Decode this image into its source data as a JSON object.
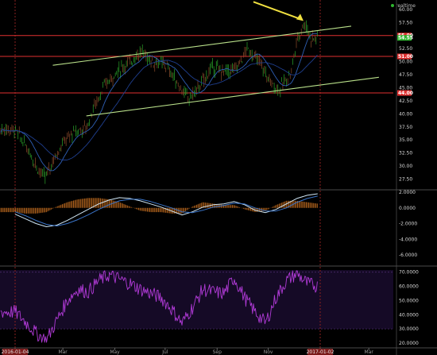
{
  "chart_data": [
    {
      "type": "candlestick",
      "panel": "price",
      "brand": "realtime",
      "y_ticks": [
        "60.00",
        "57.50",
        "55.00",
        "54.55",
        "52.50",
        "51.00",
        "50.00",
        "47.50",
        "45.00",
        "44.00",
        "42.50",
        "40.00",
        "37.50",
        "35.00",
        "32.50",
        "30.00",
        "27.50"
      ],
      "ylim": [
        25.6,
        61.5
      ],
      "x_ticks": [
        "2016-01-04",
        "Mar",
        "May",
        "Jul",
        "Sep",
        "Nov",
        "2017-01-02",
        "Mar"
      ],
      "horizontal_levels": [
        {
          "value": 55.0,
          "label": "55.00",
          "color": "#e03030"
        },
        {
          "value": 54.55,
          "label": "54.55",
          "color": "#2fb52f"
        },
        {
          "value": 51.0,
          "label": "51.00",
          "color": "#e03030"
        },
        {
          "value": 44.0,
          "label": "44.00",
          "color": "#e03030"
        }
      ],
      "price_series": [
        {
          "date": "2016-01-04",
          "close": 37.0
        },
        {
          "date": "2016-01-20",
          "close": 33.0
        },
        {
          "date": "2016-02-02",
          "close": 29.0
        },
        {
          "date": "2016-02-09",
          "close": 27.8
        },
        {
          "date": "2016-02-18",
          "close": 31.0
        },
        {
          "date": "2016-03-01",
          "close": 34.5
        },
        {
          "date": "2016-03-15",
          "close": 36.5
        },
        {
          "date": "2016-03-29",
          "close": 37.3
        },
        {
          "date": "2016-04-06",
          "close": 41.0
        },
        {
          "date": "2016-04-20",
          "close": 45.5
        },
        {
          "date": "2016-05-04",
          "close": 48.0
        },
        {
          "date": "2016-05-20",
          "close": 50.0
        },
        {
          "date": "2016-06-03",
          "close": 52.0
        },
        {
          "date": "2016-06-15",
          "close": 50.0
        },
        {
          "date": "2016-07-01",
          "close": 49.5
        },
        {
          "date": "2016-07-15",
          "close": 46.0
        },
        {
          "date": "2016-07-29",
          "close": 42.8
        },
        {
          "date": "2016-08-12",
          "close": 45.5
        },
        {
          "date": "2016-08-26",
          "close": 49.0
        },
        {
          "date": "2016-09-09",
          "close": 48.0
        },
        {
          "date": "2016-09-23",
          "close": 48.5
        },
        {
          "date": "2016-10-07",
          "close": 52.5
        },
        {
          "date": "2016-10-21",
          "close": 50.0
        },
        {
          "date": "2016-11-04",
          "close": 46.0
        },
        {
          "date": "2016-11-14",
          "close": 44.5
        },
        {
          "date": "2016-11-28",
          "close": 48.0
        },
        {
          "date": "2016-12-05",
          "close": 54.0
        },
        {
          "date": "2016-12-14",
          "close": 57.5
        },
        {
          "date": "2016-12-22",
          "close": 54.5
        },
        {
          "date": "2016-12-30",
          "close": 54.55
        }
      ],
      "trendlines": [
        {
          "from": {
            "date": "2016-02-18",
            "value": 49.3
          },
          "to": {
            "date": "2017-02-08",
            "value": 56.8
          }
        },
        {
          "from": {
            "date": "2016-03-29",
            "value": 39.6
          },
          "to": {
            "date": "2017-03-13",
            "value": 47.0
          }
        }
      ],
      "annotation": {
        "type": "arrow",
        "color": "#f0e040",
        "points_to": {
          "date": "2016-12-14",
          "value": 57.8
        }
      }
    },
    {
      "type": "line",
      "panel": "macd",
      "y_ticks": [
        "2.0000",
        "0.0000",
        "-2.0000",
        "-4.0000",
        "-6.0000"
      ],
      "ylim": [
        -6.6,
        2.2
      ],
      "series": [
        {
          "color": "#cfe6f5",
          "values": [
            -0.8,
            -1.4,
            -2.0,
            -2.4,
            -2.2,
            -1.6,
            -0.9,
            -0.2,
            0.5,
            1.0,
            1.3,
            1.2,
            0.9,
            0.5,
            0.1,
            -0.4,
            -0.9,
            -0.5,
            0.1,
            0.4,
            0.5,
            0.8,
            0.4,
            -0.3,
            -0.6,
            -0.2,
            0.5,
            1.2,
            1.6,
            1.8
          ]
        },
        {
          "color": "#3a74c8",
          "values": [
            -0.5,
            -1.0,
            -1.6,
            -2.1,
            -2.3,
            -2.0,
            -1.5,
            -0.9,
            -0.2,
            0.4,
            0.9,
            1.1,
            1.1,
            0.8,
            0.4,
            0.0,
            -0.5,
            -0.6,
            -0.3,
            0.1,
            0.3,
            0.6,
            0.5,
            0.0,
            -0.4,
            -0.4,
            0.0,
            0.7,
            1.2,
            1.5
          ]
        }
      ]
    },
    {
      "type": "line",
      "panel": "rsi",
      "y_ticks": [
        "70.0000",
        "60.0000",
        "50.0000",
        "40.0000",
        "30.0000",
        "20.0000"
      ],
      "ylim": [
        20.0,
        71.5
      ],
      "band": [
        30,
        70
      ],
      "series": [
        {
          "color": "#b03ad6",
          "values": [
            42,
            35,
            27,
            22,
            36,
            50,
            58,
            56,
            64,
            68,
            65,
            62,
            58,
            55,
            52,
            44,
            34,
            45,
            58,
            56,
            55,
            66,
            52,
            42,
            34,
            52,
            64,
            69,
            62,
            60
          ]
        }
      ]
    }
  ]
}
